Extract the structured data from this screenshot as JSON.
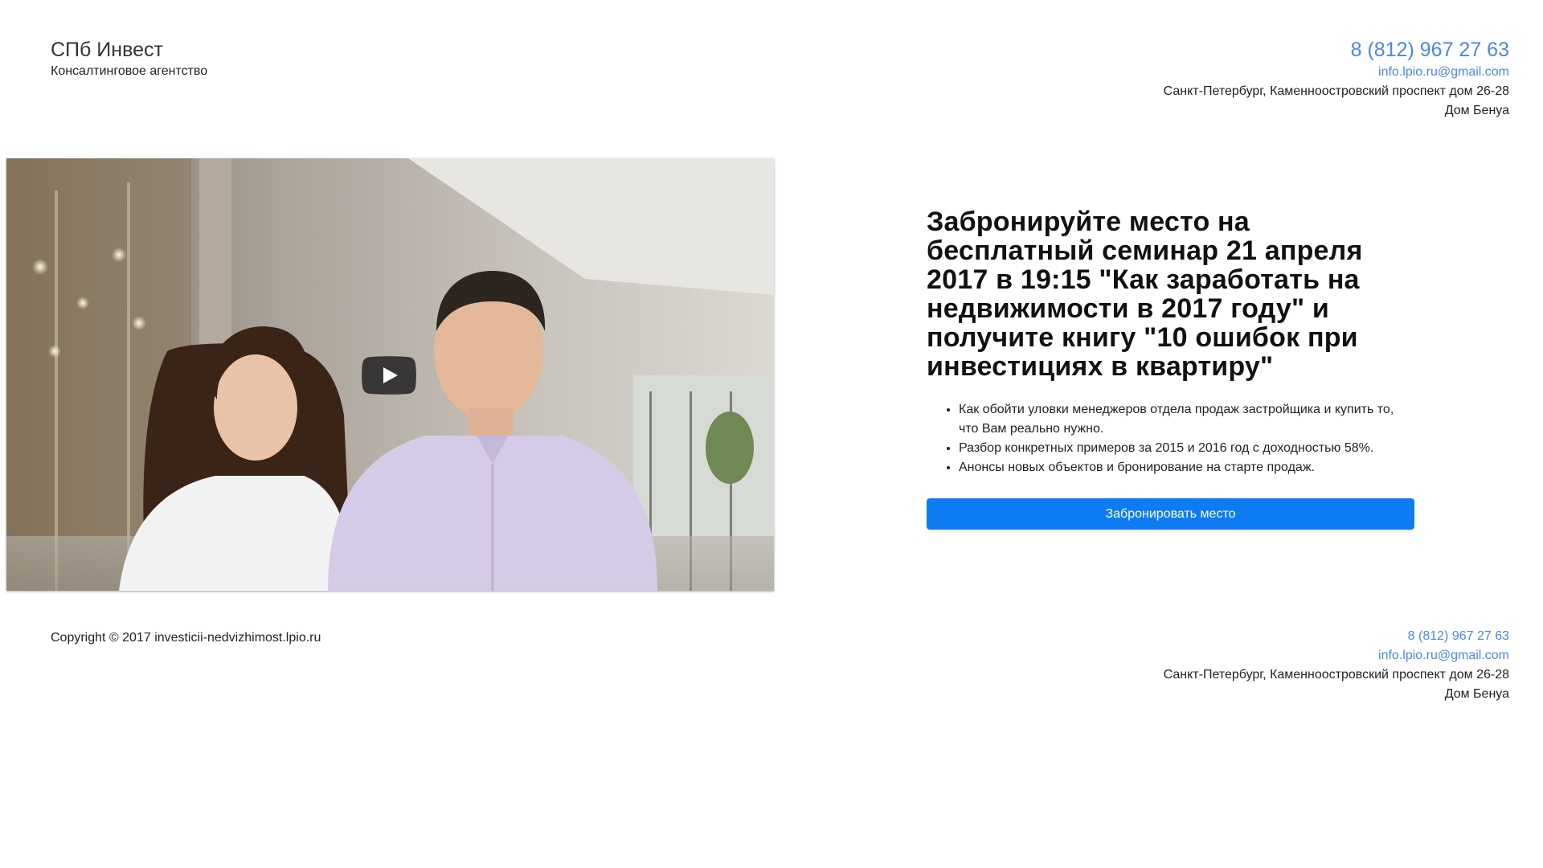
{
  "header": {
    "brand_name": "СПб Инвест",
    "brand_subtitle": "Консалтинговое агентство",
    "phone": "8 (812) 967 27 63",
    "email": "info.lpio.ru@gmail.com",
    "address_line1": "Санкт-Петербург, Каменноостровский проспект дом 26-28",
    "address_line2": "Дом Бенуа"
  },
  "video": {
    "play_icon": "play-icon"
  },
  "offer": {
    "title": "Забронируйте место на бесплатный семинар 21 апреля 2017 в 19:15 \"Как заработать на недвижимости в 2017 году\" и получите книгу \"10 ошибок при инвестициях в квартиру\"",
    "benefits": [
      "Как обойти уловки менеджеров отдела продаж застройщика и купить то, что Вам реально нужно.",
      "Разбор конкретных примеров за 2015 и 2016 год с доходностью 58%.",
      "Анонсы новых объектов и бронирование на старте продаж."
    ],
    "button_label": "Забронировать место"
  },
  "footer": {
    "copyright": "Copyright © 2017 investicii-nedvizhimost.lpio.ru",
    "phone": "8 (812) 967 27 63",
    "email": "info.lpio.ru@gmail.com",
    "address_line1": "Санкт-Петербург, Каменноостровский проспект дом 26-28",
    "address_line2": "Дом Бенуа"
  },
  "colors": {
    "link": "#4a86e8",
    "button": "#0d7cf2",
    "play_button": "#212121"
  }
}
